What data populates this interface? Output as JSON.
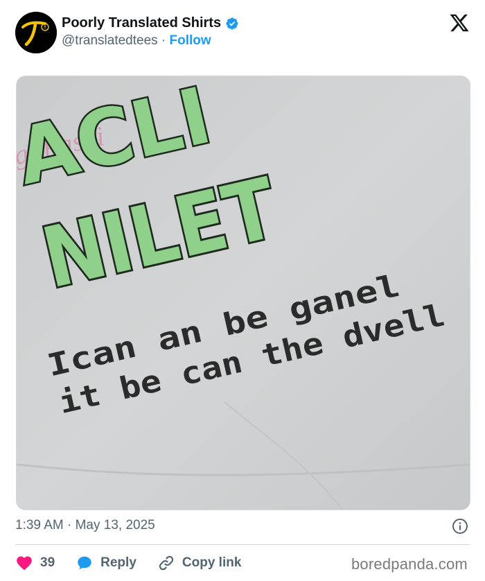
{
  "account": {
    "name": "Poorly Translated Shirts",
    "handle": "@translatedtees",
    "separator": "·",
    "follow_label": "Follow"
  },
  "icons": {
    "avatar": "t-logo-avatar",
    "verified": "verified-badge-icon",
    "platform": "x-logo-icon",
    "info": "info-icon",
    "like": "heart-icon",
    "reply": "reply-bubble-icon",
    "copy": "link-icon"
  },
  "colors": {
    "accent": "#1d9bf0",
    "like": "#f91880",
    "muted": "#536471",
    "shirt_green": "#8fd08a"
  },
  "shirt": {
    "brand_script": "imigi Fashi",
    "word_top": "ACLI",
    "word_main": "NILET",
    "line1": "Ican an be ganel",
    "line2": "it be can the dvell"
  },
  "post": {
    "time": "1:39 AM",
    "separator": "·",
    "date": "May 13, 2025"
  },
  "actions": {
    "like_count": "39",
    "reply_label": "Reply",
    "copy_label": "Copy link"
  },
  "watermark": "boredpanda.com"
}
